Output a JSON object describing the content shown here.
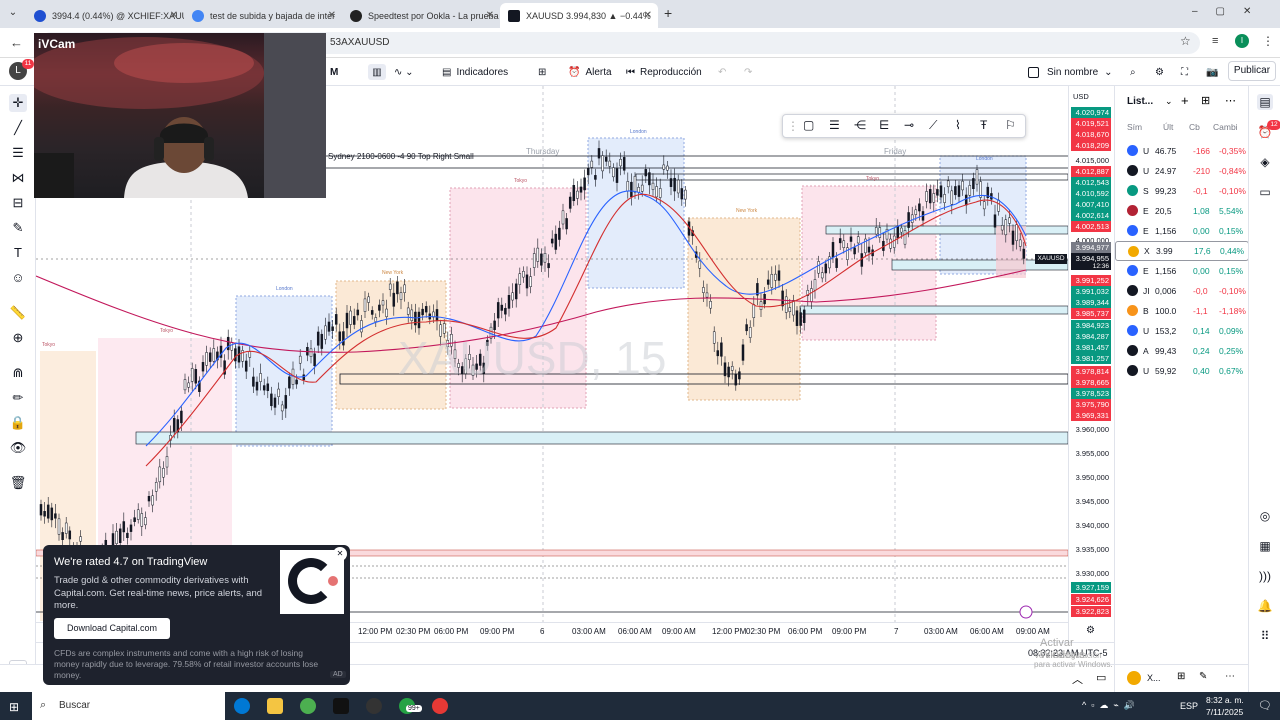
{
  "browser": {
    "tabs": [
      {
        "title": "3994.4 (0.44%) @ XCHIEF:XAUUSD",
        "active": false,
        "color": "#1f4fd1"
      },
      {
        "title": "test de subida y bajada de inter",
        "active": false,
        "color": "#4285f4"
      },
      {
        "title": "Speedtest por Ookla - La prueba",
        "active": false,
        "color": "#222222"
      },
      {
        "title": "XAUUSD 3.994,830 ▲ −0.44%",
        "active": true,
        "color": "#131722"
      }
    ],
    "new_tab": "+",
    "url": "53AXAUUSD",
    "profile_letter": "I"
  },
  "webcam": {
    "label": "iVCam"
  },
  "toolbar": {
    "avatar_letter": "L",
    "notification_count": "11",
    "interval": "M",
    "indicators": "Indicadores",
    "alert": "Alerta",
    "replay": "Reproducción",
    "layout_name": "Sin nombre",
    "publish": "Publicar"
  },
  "chart": {
    "watermark": "XAUUSD, 15",
    "session_label": "Sydney 2100-0600 -4 90 Top Right Small",
    "day_labels": [
      "Thursday",
      "Friday"
    ],
    "session_tags": [
      "Tokyo",
      "London",
      "New York",
      "Tokyo",
      "London",
      "New York",
      "Tokyo",
      "London",
      "New York",
      "Tokyo"
    ],
    "symbol_tag": "XAUUSD",
    "countdown": "12:36",
    "currency": "USD",
    "accent_colors": {
      "up": "#089981",
      "down": "#f23645",
      "blue": "#2962ff"
    }
  },
  "price_axis": [
    {
      "v": "4.020,974",
      "c": "#089981"
    },
    {
      "v": "4.019,521",
      "c": "#f23645"
    },
    {
      "v": "4.018,670",
      "c": "#f23645"
    },
    {
      "v": "4.018,209",
      "c": "#f23645"
    },
    {
      "v": "4.015,000",
      "c": ""
    },
    {
      "v": "4.012,887",
      "c": "#f23645"
    },
    {
      "v": "4.012,543",
      "c": "#089981"
    },
    {
      "v": "4.010,592",
      "c": "#089981"
    },
    {
      "v": "4.007,410",
      "c": "#089981"
    },
    {
      "v": "4.002,614",
      "c": "#089981"
    },
    {
      "v": "4.002,513",
      "c": "#f23645"
    },
    {
      "v": "4.000,000",
      "c": ""
    },
    {
      "v": "3.994,977",
      "c": "#787b86"
    },
    {
      "v": "3.994,955",
      "c": "#131722"
    },
    {
      "v": "3.991,252",
      "c": "#f23645"
    },
    {
      "v": "3.991,032",
      "c": "#089981"
    },
    {
      "v": "3.989,344",
      "c": "#089981"
    },
    {
      "v": "3.985,737",
      "c": "#f23645"
    },
    {
      "v": "3.984,923",
      "c": "#089981"
    },
    {
      "v": "3.984,287",
      "c": "#089981"
    },
    {
      "v": "3.981,457",
      "c": "#089981"
    },
    {
      "v": "3.981,257",
      "c": "#089981"
    },
    {
      "v": "3.978,814",
      "c": "#f23645"
    },
    {
      "v": "3.978,665",
      "c": "#f23645"
    },
    {
      "v": "3.978,523",
      "c": "#089981"
    },
    {
      "v": "3.975,790",
      "c": "#f23645"
    },
    {
      "v": "3.969,331",
      "c": "#f23645"
    },
    {
      "v": "3.960,000",
      "c": ""
    },
    {
      "v": "3.955,000",
      "c": ""
    },
    {
      "v": "3.950,000",
      "c": ""
    },
    {
      "v": "3.945,000",
      "c": ""
    },
    {
      "v": "3.940,000",
      "c": ""
    },
    {
      "v": "3.935,000",
      "c": ""
    },
    {
      "v": "3.930,000",
      "c": ""
    },
    {
      "v": "3.927,159",
      "c": "#089981"
    },
    {
      "v": "3.924,626",
      "c": "#f23645"
    },
    {
      "v": "3.922,823",
      "c": "#f23645"
    }
  ],
  "time_axis": [
    "12:00 PM",
    "02:30 PM",
    "06:00 PM",
    "09:00 PM",
    "6",
    "03:00 AM",
    "06:00 AM",
    "09:00 AM",
    "12:00 PM",
    "02:30 PM",
    "06:00 PM",
    "09:00 PM",
    "7",
    "03:00 AM",
    "06:00 AM",
    "09:00 AM"
  ],
  "status": {
    "clock": "08:32:23 AM UTC-5",
    "activate_title": "Activar Windows",
    "activate_sub": "Ve a Configuración para activar Windows."
  },
  "watchlist": {
    "title": "List...",
    "headers": {
      "symbol": "Sím",
      "last": "Últ",
      "change": "Cb",
      "change_pct": "Cambi"
    },
    "rows": [
      {
        "icon_color": "#2962ff",
        "sym": "U",
        "last": "46.75",
        "chg": "-166",
        "pct": "-0,35%",
        "up": false
      },
      {
        "icon_color": "#131722",
        "sym": "U",
        "last": "24.97",
        "chg": "-210",
        "pct": "-0,84%",
        "up": false
      },
      {
        "icon_color": "#089981",
        "sym": "S",
        "last": "99,23",
        "chg": "-0,1",
        "pct": "-0,10%",
        "up": false
      },
      {
        "icon_color": "#b22234",
        "sym": "E",
        "last": "20,5",
        "chg": "1,08",
        "pct": "5,54%",
        "up": true
      },
      {
        "icon_color": "#2962ff",
        "sym": "E",
        "last": "1,156",
        "chg": "0,00",
        "pct": "0,15%",
        "up": true
      },
      {
        "icon_color": "#f2a900",
        "sym": "X",
        "last": "3.99",
        "chg": "17,6",
        "pct": "0,44%",
        "up": true
      },
      {
        "icon_color": "#2962ff",
        "sym": "E",
        "last": "1,156",
        "chg": "0,00",
        "pct": "0,15%",
        "up": true
      },
      {
        "icon_color": "#131722",
        "sym": "JI",
        "last": "0,006",
        "chg": "-0,0",
        "pct": "-0,10%",
        "up": false
      },
      {
        "icon_color": "#f7931a",
        "sym": "B",
        "last": "100.0",
        "chg": "-1,1",
        "pct": "-1,18%",
        "up": false
      },
      {
        "icon_color": "#2962ff",
        "sym": "U",
        "last": "153,2",
        "chg": "0,14",
        "pct": "0,09%",
        "up": true
      },
      {
        "icon_color": "#131722",
        "sym": "A",
        "last": "99,43",
        "chg": "0,24",
        "pct": "0,25%",
        "up": true
      },
      {
        "icon_color": "#131722",
        "sym": "U",
        "last": "59,92",
        "chg": "0,40",
        "pct": "0,67%",
        "up": true
      }
    ],
    "bottom_sym": "X..."
  },
  "right_badge": "12",
  "ad": {
    "title": "We're rated 4.7 on TradingView",
    "body": "Trade gold & other commodity derivatives with Capital.com. Get real-time news, price alerts, and more.",
    "button": "Download Capital.com",
    "disclaimer": "CFDs are complex instruments and come with a high risk of losing money rapidly due to leverage. 79.58% of retail investor accounts lose money.",
    "badge": "AD"
  },
  "taskbar": {
    "search": "Buscar",
    "badge": "99+",
    "lang": "ESP",
    "time": "8:32 a. m.",
    "date": "7/11/2025"
  }
}
